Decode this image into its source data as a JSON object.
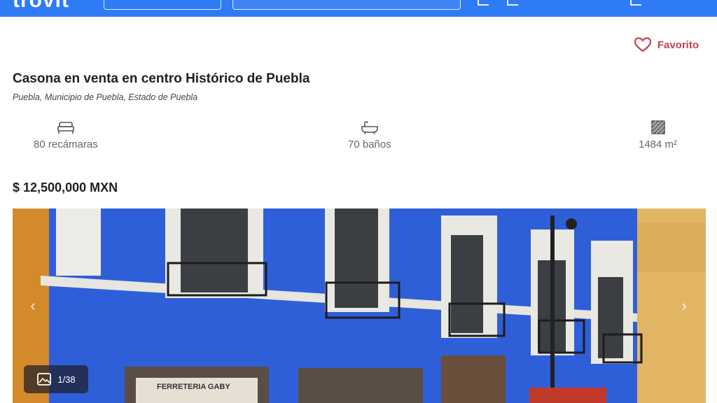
{
  "header": {
    "logo": "trovit"
  },
  "favorite": {
    "label": "Favorito",
    "icon": "heart-icon",
    "color": "#c2434d"
  },
  "listing": {
    "title": "Casona en venta en centro Histórico de Puebla",
    "location": "Puebla, Municipio de Puebla, Estado de Puebla",
    "features": [
      {
        "icon": "bed-icon",
        "label": "80 recámaras"
      },
      {
        "icon": "bathtub-icon",
        "label": "70 baños"
      },
      {
        "icon": "area-icon",
        "label": "1484 m²"
      }
    ],
    "price": "$ 12,500,000 MXN"
  },
  "gallery": {
    "counter": "1/38",
    "counter_icon": "image-icon"
  },
  "photo": {
    "sign_left": "FERRETERIA GABY"
  },
  "colors": {
    "brand_blue": "#2f7bf6",
    "facade_blue": "#2d5bd8",
    "accent_red": "#c2434d"
  }
}
